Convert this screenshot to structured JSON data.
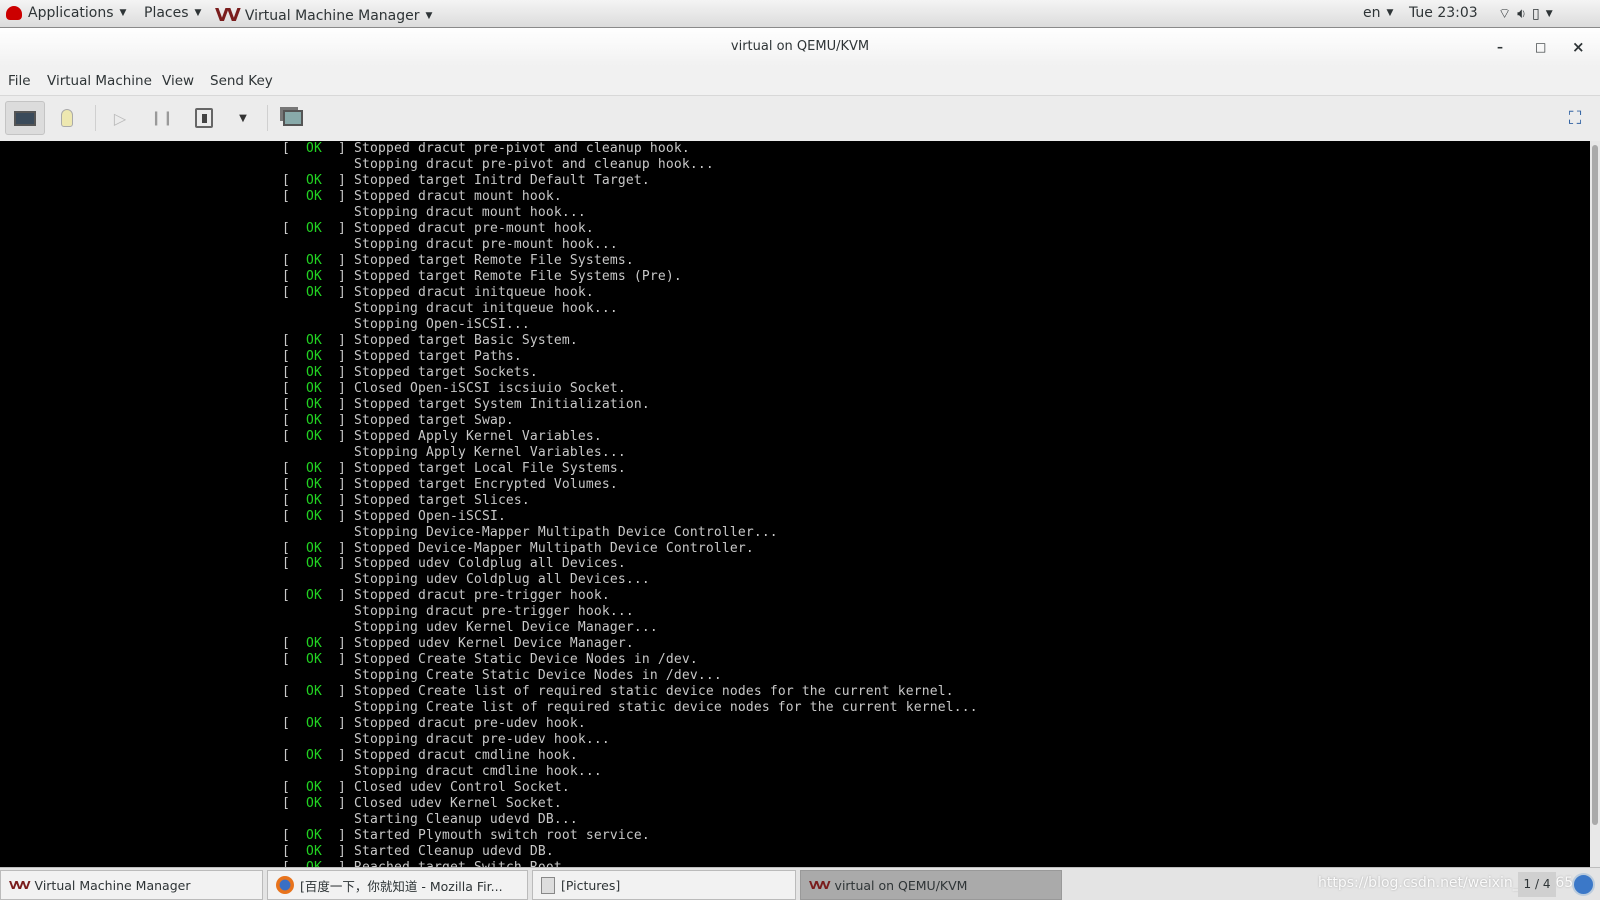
{
  "topbar": {
    "applications": "Applications",
    "places": "Places",
    "app_name": "Virtual Machine Manager",
    "lang": "en",
    "clock": "Tue 23:03",
    "icons": [
      "redhat-icon",
      "wifi-icon",
      "volume-icon",
      "battery-icon"
    ]
  },
  "window": {
    "title": "virtual on QEMU/KVM",
    "minimize": "–",
    "maximize": "□",
    "close": "×"
  },
  "menu": [
    "File",
    "Virtual Machine",
    "View",
    "Send Key"
  ],
  "toolbar": {
    "icons": [
      "console-icon",
      "details-lightbulb-icon",
      "run-icon",
      "pause-icon",
      "shutdown-icon",
      "shutdown-dropdown-icon",
      "snapshots-icon",
      "fullscreen-icon"
    ]
  },
  "console": {
    "lines": [
      {
        "ok": true,
        "text": "Stopped dracut pre-pivot and cleanup hook."
      },
      {
        "ok": false,
        "text": "Stopping dracut pre-pivot and cleanup hook..."
      },
      {
        "ok": true,
        "text": "Stopped target Initrd Default Target."
      },
      {
        "ok": true,
        "text": "Stopped dracut mount hook."
      },
      {
        "ok": false,
        "text": "Stopping dracut mount hook..."
      },
      {
        "ok": true,
        "text": "Stopped dracut pre-mount hook."
      },
      {
        "ok": false,
        "text": "Stopping dracut pre-mount hook..."
      },
      {
        "ok": true,
        "text": "Stopped target Remote File Systems."
      },
      {
        "ok": true,
        "text": "Stopped target Remote File Systems (Pre)."
      },
      {
        "ok": true,
        "text": "Stopped dracut initqueue hook."
      },
      {
        "ok": false,
        "text": "Stopping dracut initqueue hook..."
      },
      {
        "ok": false,
        "text": "Stopping Open-iSCSI..."
      },
      {
        "ok": true,
        "text": "Stopped target Basic System."
      },
      {
        "ok": true,
        "text": "Stopped target Paths."
      },
      {
        "ok": true,
        "text": "Stopped target Sockets."
      },
      {
        "ok": true,
        "text": "Closed Open-iSCSI iscsiuio Socket."
      },
      {
        "ok": true,
        "text": "Stopped target System Initialization."
      },
      {
        "ok": true,
        "text": "Stopped target Swap."
      },
      {
        "ok": true,
        "text": "Stopped Apply Kernel Variables."
      },
      {
        "ok": false,
        "text": "Stopping Apply Kernel Variables..."
      },
      {
        "ok": true,
        "text": "Stopped target Local File Systems."
      },
      {
        "ok": true,
        "text": "Stopped target Encrypted Volumes."
      },
      {
        "ok": true,
        "text": "Stopped target Slices."
      },
      {
        "ok": true,
        "text": "Stopped Open-iSCSI."
      },
      {
        "ok": false,
        "text": "Stopping Device-Mapper Multipath Device Controller..."
      },
      {
        "ok": true,
        "text": "Stopped Device-Mapper Multipath Device Controller."
      },
      {
        "ok": true,
        "text": "Stopped udev Coldplug all Devices."
      },
      {
        "ok": false,
        "text": "Stopping udev Coldplug all Devices..."
      },
      {
        "ok": true,
        "text": "Stopped dracut pre-trigger hook."
      },
      {
        "ok": false,
        "text": "Stopping dracut pre-trigger hook..."
      },
      {
        "ok": false,
        "text": "Stopping udev Kernel Device Manager..."
      },
      {
        "ok": true,
        "text": "Stopped udev Kernel Device Manager."
      },
      {
        "ok": true,
        "text": "Stopped Create Static Device Nodes in /dev."
      },
      {
        "ok": false,
        "text": "Stopping Create Static Device Nodes in /dev..."
      },
      {
        "ok": true,
        "text": "Stopped Create list of required static device nodes for the current kernel."
      },
      {
        "ok": false,
        "text": "Stopping Create list of required static device nodes for the current kernel..."
      },
      {
        "ok": true,
        "text": "Stopped dracut pre-udev hook."
      },
      {
        "ok": false,
        "text": "Stopping dracut pre-udev hook..."
      },
      {
        "ok": true,
        "text": "Stopped dracut cmdline hook."
      },
      {
        "ok": false,
        "text": "Stopping dracut cmdline hook..."
      },
      {
        "ok": true,
        "text": "Closed udev Control Socket."
      },
      {
        "ok": true,
        "text": "Closed udev Kernel Socket."
      },
      {
        "ok": false,
        "text": "Starting Cleanup udevd DB..."
      },
      {
        "ok": true,
        "text": "Started Plymouth switch root service."
      },
      {
        "ok": true,
        "text": "Started Cleanup udevd DB."
      },
      {
        "ok": true,
        "text": "Reached target Switch Root."
      }
    ],
    "ok_label": "OK",
    "ok_color": "#22d322"
  },
  "taskbar": {
    "items": [
      {
        "label": "Virtual Machine Manager",
        "icon": "vmm-icon",
        "active": false
      },
      {
        "label": "[百度一下，你就知道 - Mozilla Fir...",
        "icon": "firefox-icon",
        "active": false
      },
      {
        "label": "[Pictures]",
        "icon": "file-manager-icon",
        "active": false
      },
      {
        "label": "virtual on QEMU/KVM",
        "icon": "vmm-icon",
        "active": true
      }
    ],
    "watermark": "https://blog.csdn.net/weixin_42996549",
    "workspace": "1 / 4"
  }
}
